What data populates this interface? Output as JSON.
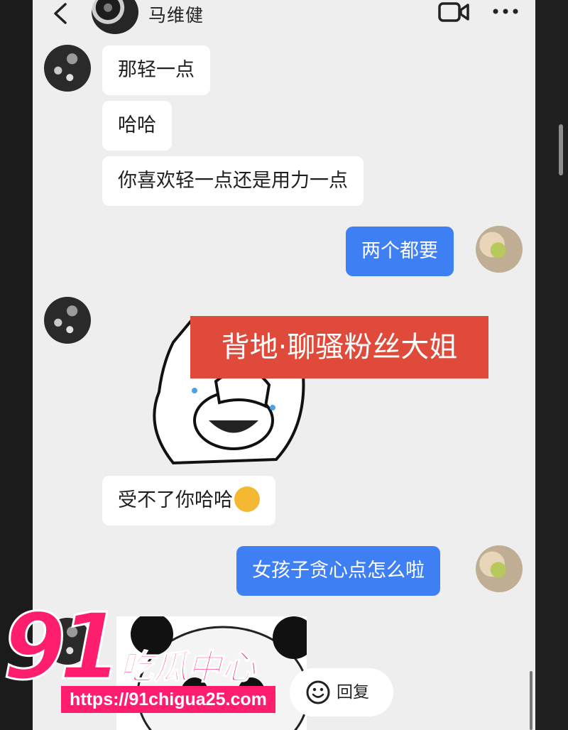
{
  "header": {
    "title": "马维健",
    "back_icon": "chevron-left-icon",
    "video_icon": "video-call-icon",
    "more_icon": "more-horizontal-icon"
  },
  "messages": [
    {
      "side": "received",
      "text": "那轻一点"
    },
    {
      "side": "received",
      "text": "哈哈"
    },
    {
      "side": "received",
      "text": "你喜欢轻一点还是用力一点"
    },
    {
      "side": "sent",
      "text": "两个都要"
    },
    {
      "side": "received",
      "type": "sticker",
      "text": "背地·聊骚粉丝大姐"
    },
    {
      "side": "received",
      "text": "受不了你哈哈",
      "emoji": "grinning-face-icon"
    },
    {
      "side": "sent",
      "text": "女孩子贪心点怎么啦"
    },
    {
      "side": "received",
      "type": "sticker",
      "sticker": "panda-meme"
    }
  ],
  "reply_button": {
    "label": "回复",
    "icon": "smile-icon"
  },
  "watermark": {
    "number": "91",
    "name": "吃瓜中心",
    "url": "https://91chigua25.com"
  },
  "colors": {
    "sent_bubble": "#3f7ff4",
    "received_bubble": "#ffffff",
    "background": "#eeeeef",
    "banner": "#e04a3b",
    "watermark": "#ff1e6e"
  }
}
